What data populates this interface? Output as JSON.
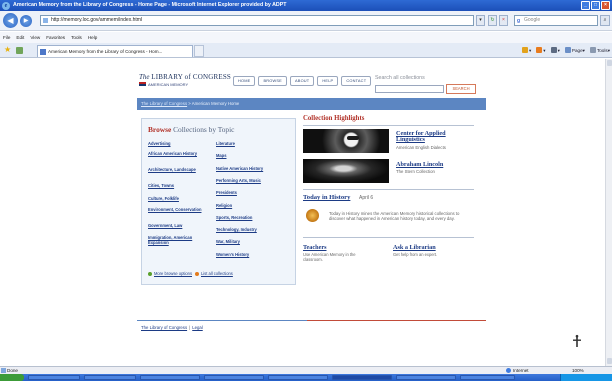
{
  "browser": {
    "title": "American Memory from the Library of Congress - Home Page - Microsoft Internet Explorer provided by ADPT",
    "url": "http://memory.loc.gov/ammem/index.html",
    "search_placeholder": "Google",
    "menus": [
      "File",
      "Edit",
      "View",
      "Favorites",
      "Tools",
      "Help"
    ],
    "tab_title": "American Memory from the Library of Congress - Hom...",
    "commands": [
      {
        "label": "",
        "icon": "home-icon",
        "color": "#e2a21c"
      },
      {
        "label": "",
        "icon": "feeds-icon",
        "color": "#e87b1d"
      },
      {
        "label": "",
        "icon": "print-icon",
        "color": "#5d6b82"
      },
      {
        "label": "Page",
        "icon": "page-icon",
        "color": "#6b8fc7"
      },
      {
        "label": "Tools",
        "icon": "tools-icon",
        "color": "#8a99b0"
      }
    ],
    "status": {
      "text": "Done",
      "zone": "Internet",
      "zoom": "100%"
    }
  },
  "site": {
    "logo_line1_prefix": "The",
    "logo_line1_main": "LIBRARY of CONGRESS",
    "logo_line2": "AMERICAN MEMORY",
    "nav": [
      "HOME",
      "BROWSE",
      "ABOUT",
      "HELP",
      "CONTACT"
    ],
    "search_label": "Search all collections",
    "search_button": "SEARCH",
    "breadcrumb": {
      "link": "The Library of Congress",
      "separator": ">",
      "current": "American Memory Home"
    },
    "browse": {
      "title_strong": "Browse",
      "title_rest": "Collections by Topic",
      "left_topics": [
        "Advertising",
        "African American History",
        "Architecture, Landscape",
        "Cities, Towns",
        "Culture, Folklife",
        "Environment, Conservation",
        "Government, Law",
        "Immigration, American Expansion"
      ],
      "right_topics": [
        "Literature",
        "Maps",
        "Native American History",
        "Performing Arts, Music",
        "Presidents",
        "Religion",
        "Sports, Recreation",
        "Technology, Industry",
        "War, Military",
        "Women's History"
      ],
      "more_options": "More browse options",
      "list_all": "List all collections",
      "more_dot_color": "#5aa02c",
      "list_dot_color": "#e37b1c"
    },
    "highlights": {
      "title": "Collection Highlights",
      "items": [
        {
          "link": "Center for Applied Linguistics",
          "subtitle": "American English Dialects"
        },
        {
          "link": "Abraham Lincoln",
          "subtitle": "The Stern Collection"
        }
      ]
    },
    "today": {
      "heading": "Today in History",
      "date": "April 6",
      "text": "Today in History mines the American Memory historical collections to discover what happened in American history today, and every day."
    },
    "teachers": {
      "link": "Teachers",
      "text": "Use American Memory in the classroom."
    },
    "librarian": {
      "link": "Ask a Librarian",
      "text": "Get help from an expert."
    },
    "footer": {
      "link1": "The Library of Congress",
      "separator": "|",
      "link2": "Legal"
    }
  }
}
